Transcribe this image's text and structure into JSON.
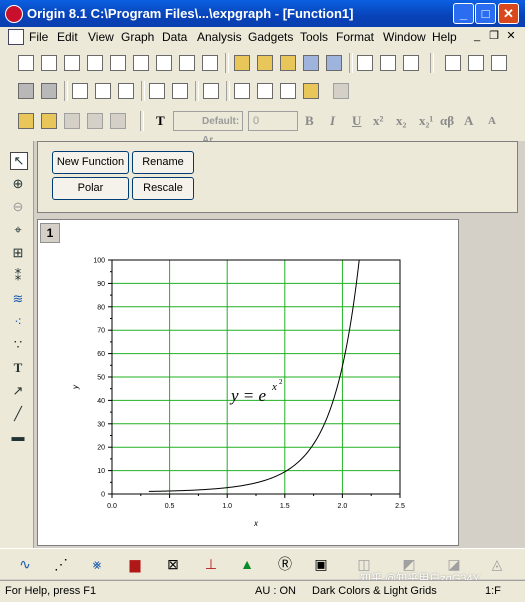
{
  "window": {
    "title": "Origin 8.1 C:\\Program Files\\...\\expgraph - [Function1]"
  },
  "title_buttons": {
    "minimize": "_",
    "maximize": "□",
    "close": "✕"
  },
  "menu": [
    "File",
    "Edit",
    "View",
    "Graph",
    "Data",
    "Analysis",
    "Gadgets",
    "Tools",
    "Format",
    "Window",
    "Help"
  ],
  "mdi_buttons": {
    "minimize": "_",
    "restore": "❐",
    "close": "✕"
  },
  "format_toolbar": {
    "font": "Default: Ar",
    "size": "0",
    "bold": "B",
    "italic": "I",
    "underline": "U",
    "superscript": "x²",
    "subscript": "x₂",
    "supersub": "x₂¹",
    "greek": "αβ",
    "grow": "A",
    "shrink": "A"
  },
  "buttons": {
    "new_function": "New Function",
    "rename": "Rename",
    "polar": "Polar",
    "rescale": "Rescale"
  },
  "layer": {
    "number": "1"
  },
  "chart_data": {
    "type": "line",
    "function_label": "y = e",
    "exponent_label": "x",
    "exponent_power": "2",
    "xlabel": "x",
    "ylabel": "y",
    "xlim": [
      0.0,
      2.5
    ],
    "ylim": [
      0,
      100
    ],
    "x_ticks": [
      "0.0",
      "0.5",
      "1.0",
      "1.5",
      "2.0",
      "2.5"
    ],
    "y_ticks": [
      "0",
      "10",
      "20",
      "30",
      "40",
      "50",
      "60",
      "70",
      "80",
      "90",
      "100"
    ],
    "grid": true,
    "grid_color": "#22b022",
    "line_color": "#000000",
    "x_range": [
      0.32,
      2.146
    ],
    "function": "exp(x^2)"
  },
  "status": {
    "help": "For Help, press F1",
    "au": "AU : ON",
    "theme": "Dark Colors & Light Grids",
    "page": "1:F"
  },
  "watermark": "知乎 @知乎用户zqG34Y"
}
